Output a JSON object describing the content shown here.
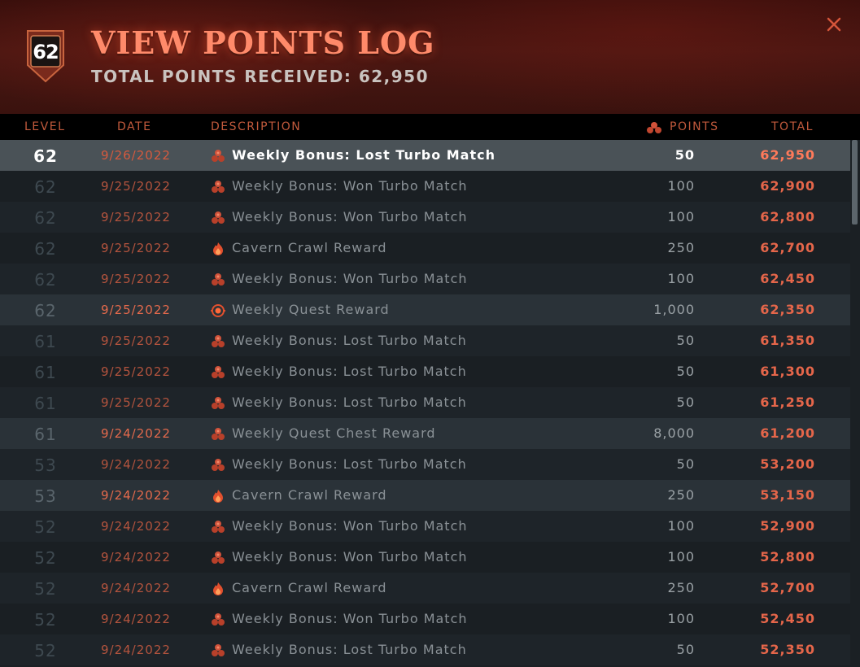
{
  "header": {
    "level": "62",
    "title": "VIEW POINTS LOG",
    "subtitle": "TOTAL POINTS RECEIVED: 62,950",
    "close_icon": "close-x-icon",
    "accent_color": "#ff8a6a"
  },
  "columns": {
    "level": "LEVEL",
    "date": "DATE",
    "description": "DESCRIPTION",
    "points": "POINTS",
    "total": "TOTAL"
  },
  "rows": [
    {
      "level": "62",
      "date": "9/26/2022",
      "icon": "turbo-match-icon",
      "description": "Weekly Bonus: Lost Turbo Match",
      "points": "50",
      "total": "62,950",
      "state": "selected"
    },
    {
      "level": "62",
      "date": "9/25/2022",
      "icon": "turbo-match-icon",
      "description": "Weekly Bonus: Won Turbo Match",
      "points": "100",
      "total": "62,900",
      "state": "even"
    },
    {
      "level": "62",
      "date": "9/25/2022",
      "icon": "turbo-match-icon",
      "description": "Weekly Bonus: Won Turbo Match",
      "points": "100",
      "total": "62,800",
      "state": "odd"
    },
    {
      "level": "62",
      "date": "9/25/2022",
      "icon": "cavern-crawl-icon",
      "description": "Cavern Crawl Reward",
      "points": "250",
      "total": "62,700",
      "state": "even"
    },
    {
      "level": "62",
      "date": "9/25/2022",
      "icon": "turbo-match-icon",
      "description": "Weekly Bonus: Won Turbo Match",
      "points": "100",
      "total": "62,450",
      "state": "odd"
    },
    {
      "level": "62",
      "date": "9/25/2022",
      "icon": "weekly-quest-icon",
      "description": "Weekly Quest Reward",
      "points": "1,000",
      "total": "62,350",
      "state": "hl"
    },
    {
      "level": "61",
      "date": "9/25/2022",
      "icon": "turbo-match-icon",
      "description": "Weekly Bonus: Lost Turbo Match",
      "points": "50",
      "total": "61,350",
      "state": "odd"
    },
    {
      "level": "61",
      "date": "9/25/2022",
      "icon": "turbo-match-icon",
      "description": "Weekly Bonus: Lost Turbo Match",
      "points": "50",
      "total": "61,300",
      "state": "even"
    },
    {
      "level": "61",
      "date": "9/25/2022",
      "icon": "turbo-match-icon",
      "description": "Weekly Bonus: Lost Turbo Match",
      "points": "50",
      "total": "61,250",
      "state": "odd"
    },
    {
      "level": "61",
      "date": "9/24/2022",
      "icon": "turbo-match-icon",
      "description": "Weekly Quest Chest Reward",
      "points": "8,000",
      "total": "61,200",
      "state": "hl"
    },
    {
      "level": "53",
      "date": "9/24/2022",
      "icon": "turbo-match-icon",
      "description": "Weekly Bonus: Lost Turbo Match",
      "points": "50",
      "total": "53,200",
      "state": "odd"
    },
    {
      "level": "53",
      "date": "9/24/2022",
      "icon": "cavern-crawl-icon",
      "description": "Cavern Crawl Reward",
      "points": "250",
      "total": "53,150",
      "state": "hl"
    },
    {
      "level": "52",
      "date": "9/24/2022",
      "icon": "turbo-match-icon",
      "description": "Weekly Bonus: Won Turbo Match",
      "points": "100",
      "total": "52,900",
      "state": "odd"
    },
    {
      "level": "52",
      "date": "9/24/2022",
      "icon": "turbo-match-icon",
      "description": "Weekly Bonus: Won Turbo Match",
      "points": "100",
      "total": "52,800",
      "state": "even"
    },
    {
      "level": "52",
      "date": "9/24/2022",
      "icon": "cavern-crawl-icon",
      "description": "Cavern Crawl Reward",
      "points": "250",
      "total": "52,700",
      "state": "odd"
    },
    {
      "level": "52",
      "date": "9/24/2022",
      "icon": "turbo-match-icon",
      "description": "Weekly Bonus: Won Turbo Match",
      "points": "100",
      "total": "52,450",
      "state": "even"
    },
    {
      "level": "52",
      "date": "9/24/2022",
      "icon": "turbo-match-icon",
      "description": "Weekly Bonus: Lost Turbo Match",
      "points": "50",
      "total": "52,350",
      "state": "odd"
    }
  ]
}
